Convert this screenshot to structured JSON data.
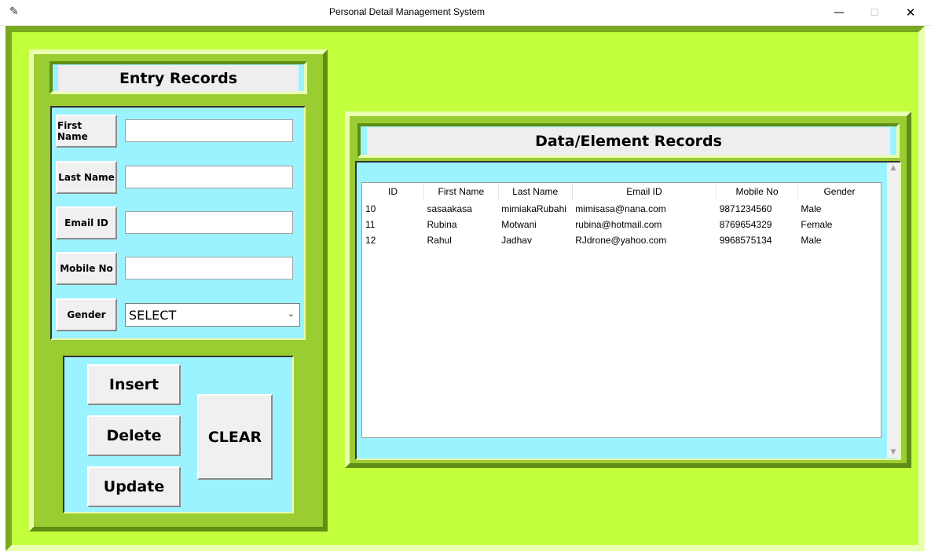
{
  "window": {
    "title": "Personal Detail Management System",
    "minimize": "—",
    "maximize": "☐",
    "close": "✕",
    "app_icon": "✎"
  },
  "entry_panel": {
    "heading": "Entry Records",
    "fields": [
      {
        "label": "First Name",
        "value": ""
      },
      {
        "label": "Last Name",
        "value": ""
      },
      {
        "label": "Email ID",
        "value": ""
      },
      {
        "label": "Mobile No",
        "value": ""
      }
    ],
    "gender": {
      "label": "Gender",
      "selected": "SELECT",
      "chevron": "⌄"
    },
    "buttons": {
      "insert": "Insert",
      "delete": "Delete",
      "update": "Update",
      "clear": "CLEAR"
    }
  },
  "records_panel": {
    "heading": "Data/Element Records",
    "columns": [
      "ID",
      "First Name",
      "Last Name",
      "Email ID",
      "Mobile No",
      "Gender"
    ],
    "rows": [
      [
        "10",
        "sasaakasa",
        "mimiakaRubahi",
        "mimisasa@nana.com",
        "9871234560",
        "Male"
      ],
      [
        "11",
        "Rubina",
        "Motwani",
        "rubina@hotmail.com",
        "8769654329",
        "Female"
      ],
      [
        "12",
        "Rahul",
        "Jadhav",
        "RJdrone@yahoo.com",
        "9968575134",
        "Male"
      ]
    ],
    "scroll_up": "▲",
    "scroll_down": "▼"
  },
  "colors": {
    "background": "#c2ff3d",
    "frame": "#9acd32",
    "panel": "#9bf3ff"
  }
}
